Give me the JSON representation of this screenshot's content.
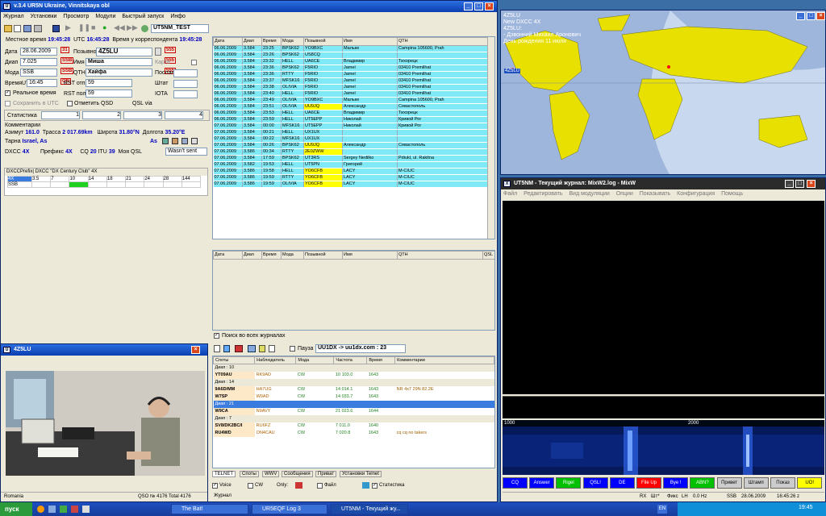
{
  "main_window": {
    "title": "v.3.4  UR5N Ukraine, Vinnitskaya obl",
    "menu": [
      "Журнал",
      "Установки",
      "Просмотр",
      "Модули",
      "Быстрый запуск",
      "Инфо"
    ],
    "profile": "UT5NM_TEST",
    "local_time_label": "Местное время",
    "local_time": "19:45:28",
    "utc_label": "UTC",
    "utc_time": "16:45:28",
    "corr_time_label": "Время у корреспондента",
    "corr_time": "19:45:28",
    "date_label": "Дата",
    "date": "28.06.2009",
    "band_label": "Диап",
    "band": "7.025",
    "mode_label": "Мода",
    "mode": "SSB",
    "time_utc_label": "ВремяUTC",
    "time_utc": "16:45",
    "callsign_label": "Позывной",
    "callsign": "4Z5LU",
    "name_label": "Имя",
    "name": "Миша",
    "qth_label": "QTH",
    "qth": "Хайфа",
    "rst_sent_label": "RST отп",
    "rst_sent": "59",
    "rst_rcvd_label": "RST пол",
    "rst_rcvd": "59",
    "realtime_label": "Реальное время",
    "save_utc_label": "Сохранить в UTC",
    "mark_qsd_label": "Отметить QSD",
    "qsl_via_label": "QSL via",
    "card_label": "Карта",
    "sent_label": "Послан",
    "state_label": "Штат",
    "iota_label": "IOTA",
    "stats_label": "Статистика",
    "stats_fields": [
      "1",
      "2",
      "3",
      "4"
    ],
    "comments_label": "Комментарии",
    "azimuth_label": "Азимут",
    "azimuth": "161.0",
    "route_label": "Трасса",
    "route": "2 017.69km",
    "lat_label": "Широта",
    "lat": "31.80°N",
    "lon_label": "Долгота",
    "lon": "35.20°E",
    "country_label": "Тарна",
    "country": "Israel, As",
    "continent": "As",
    "dxcc_label": "DXCC",
    "dxcc": "4X",
    "prefix_label": "Префикс",
    "prefix": "4X",
    "cq_label": "CQ",
    "cq": "20",
    "itu_label": "ITU",
    "itu": "39",
    "myqsl_label": "Моя QSL",
    "myqsl": "Wasn't sent",
    "dxcc_panel_title": "DXCCPrefix| DXCC \"DX Century Club\" 4X",
    "dxcc_bands": [
      "4X",
      "3.5",
      "7",
      "10",
      "14",
      "18",
      "21",
      "24",
      "28",
      "144"
    ],
    "dxcc_row2": "SSB"
  },
  "log": {
    "headers": [
      "Дата",
      "Диап",
      "Время",
      "Мода",
      "Позывной",
      "Имя",
      "QTH"
    ],
    "rows": [
      [
        "06.06.2009",
        "3.584",
        "23:25",
        "BPSK62",
        "YO9BXC",
        "Мальке",
        "Campina 105600, Prah"
      ],
      [
        "06.06.2009",
        "3.584",
        "23:26",
        "BPSK62",
        "US8CQ",
        "",
        ""
      ],
      [
        "06.06.2009",
        "3.584",
        "23:32",
        "HELL",
        "UA6CE",
        "Владимир",
        "Тихорецк"
      ],
      [
        "06.06.2009",
        "3.584",
        "23:36",
        "BPSK62",
        "F5RIO",
        "Jamel",
        "03410 Premilhat"
      ],
      [
        "06.06.2009",
        "3.584",
        "23:36",
        "RTTY",
        "F5RIO",
        "Jamel",
        "03410 Premilhat"
      ],
      [
        "06.06.2009",
        "3.584",
        "23:37",
        "MFSK16",
        "F5RIO",
        "Jamel",
        "03410 Premilhat"
      ],
      [
        "06.06.2009",
        "3.584",
        "23:38",
        "OLIVIA",
        "F5RIO",
        "Jamel",
        "03410 Premilhat"
      ],
      [
        "06.06.2009",
        "3.584",
        "23:40",
        "HELL",
        "F5RIO",
        "Jamel",
        "03410 Premilhat"
      ],
      [
        "06.06.2009",
        "3.584",
        "23:49",
        "OLIVIA",
        "YO9BXC",
        "Мальке",
        "Campina 105600, Prah"
      ],
      [
        "06.06.2009",
        "3.584",
        "23:51",
        "OLIVIA",
        "UU9JQ",
        "Александр",
        "Севастополь"
      ],
      [
        "06.06.2009",
        "3.584",
        "23:53",
        "HELL",
        "UA6CE",
        "Владимир",
        "Тихорецк"
      ],
      [
        "06.06.2009",
        "3.584",
        "23:59",
        "HELL",
        "UT5EPP",
        "Николай",
        "Кривой Рог"
      ],
      [
        "07.06.2009",
        "3.584",
        "00:00",
        "MFSK16",
        "UT5EPP",
        "Николай",
        "Кривой Рог"
      ],
      [
        "07.06.2009",
        "3.584",
        "00:21",
        "HELL",
        "UX1UX",
        "",
        ""
      ],
      [
        "07.06.2009",
        "3.584",
        "00:22",
        "MFSK16",
        "UX1UX",
        "",
        ""
      ],
      [
        "07.06.2009",
        "3.584",
        "00:26",
        "BPSK62",
        "UU9JQ",
        "Александр",
        "Севастополь"
      ],
      [
        "07.06.2009",
        "3.586",
        "00:34",
        "RTTY",
        "2E0ZWW",
        "",
        ""
      ],
      [
        "07.06.2009",
        "3.584",
        "17:59",
        "BPSK62",
        "UT3RS",
        "Sergey Nedilko",
        "Pdiukl, ul. Rakitna"
      ],
      [
        "07.06.2009",
        "3.582",
        "19:53",
        "HELL",
        "UT5PN",
        "Григорий",
        ""
      ],
      [
        "07.06.2009",
        "3.586",
        "19:58",
        "HELL",
        "YO6CFB",
        "LACY",
        "M-CIUC"
      ],
      [
        "07.06.2009",
        "3.586",
        "19:59",
        "RTTY",
        "YO6CFB",
        "LACY",
        "M-CIUC"
      ],
      [
        "07.06.2009",
        "3.586",
        "19:59",
        "OLIVIA",
        "YO6CFB",
        "LACY",
        "M-CIUC"
      ]
    ],
    "yellow_calls": [
      "UU9JQ",
      "2E0ZWW",
      "YO6CFB"
    ],
    "headers2": [
      "Дата",
      "Диап",
      "Время",
      "Мода",
      "Позывной",
      "Имя",
      "QTH",
      "QSL"
    ],
    "search_all_label": "Поиск во всех журналах"
  },
  "photo_window": {
    "title": "4Z5LU",
    "country": "Romania",
    "qso_info": "QSO № 4176  Total 4176"
  },
  "spots": {
    "toolbar_label": "Пауза",
    "cluster": "UU1DX -> uu1dx.com : 23",
    "headers": [
      "Споты",
      "Наблюдатель",
      "Мода",
      "Частота",
      "Время",
      "Комментарии"
    ],
    "groups": [
      {
        "label": "Диап : 10",
        "rows": [
          [
            "YT09AU",
            "RK9AD",
            "CW",
            "10 103.0",
            "1643",
            ""
          ]
        ]
      },
      {
        "label": "Диап : 14",
        "rows": [
          [
            "9A6D/MM",
            "HA7UG",
            "CW",
            "14 014.1",
            "1643",
            "NR 4x7 29N 82.2E"
          ],
          [
            "W7SP",
            "W0AD",
            "CW",
            "14 033.7",
            "1643",
            ""
          ]
        ]
      },
      {
        "label": "Диап : 21",
        "rows": [
          [
            "W9CA",
            "N9AVY",
            "CW",
            "21 023.6",
            "1644",
            ""
          ]
        ]
      },
      {
        "label": "Диап : 7",
        "rows": [
          [
            "SV8/DK2BC/I",
            "RU6FZ",
            "CW",
            "7 011.0",
            "1640",
            ""
          ],
          [
            "RU4WD",
            "ON4CAU",
            "CW",
            "7 020.8",
            "1643",
            "cq cq no takers"
          ]
        ]
      }
    ],
    "tabs": [
      "TELNET",
      "Споты",
      "WWV",
      "Сообщения",
      "Приват",
      "Установки Telnet"
    ],
    "filters": [
      "Voice",
      "CW",
      "Only:",
      "Файл",
      "Статистика"
    ],
    "journal_label": "Журнал"
  },
  "map": {
    "title": "4Z5LU",
    "lines": [
      "New DXCC 4X",
      "4Z5LU:",
      "- Дзвонний Михаил Аронович",
      "День рождения 11 июля"
    ],
    "marker": "4Z5LU"
  },
  "mixw": {
    "title": "UT5NM - Текущий журнал: MixW2.log - MixW",
    "menu": [
      "Файл",
      "Редактировать",
      "Вид модуляции",
      "Опции",
      "Показывать",
      "Конфигурация",
      "Помощь"
    ],
    "freq_left": "1000",
    "freq_mid": "2000",
    "macros": [
      {
        "label": "CQ",
        "color": "#0000ff"
      },
      {
        "label": "Answer",
        "color": "#0000ff"
      },
      {
        "label": "Rigel",
        "color": "#00c000"
      },
      {
        "label": "QSL!",
        "color": "#0000ff"
      },
      {
        "label": "DE",
        "color": "#0000ff"
      },
      {
        "label": "File Up",
        "color": "#ff0000"
      },
      {
        "label": "Bye !",
        "color": "#0000ff"
      },
      {
        "label": "ABN?",
        "color": "#00c000"
      },
      {
        "label": "Привет",
        "color": "#cccccc"
      },
      {
        "label": "Штамп",
        "color": "#cccccc"
      },
      {
        "label": "Показ",
        "color": "#cccccc"
      },
      {
        "label": "UO!",
        "color": "#ffff00"
      }
    ],
    "status": [
      "RX",
      "Шт*",
      "Фикс",
      "LH",
      "0.0 Hz",
      "SSB",
      "28.06.2009",
      "16:45:26 z"
    ]
  },
  "taskbar": {
    "start": "пуск",
    "buttons": [
      "The Bat!",
      "UR5EQF Log 3",
      "UT5NM - Текущий жу..."
    ],
    "lang": "EN",
    "clock": "19:45"
  }
}
